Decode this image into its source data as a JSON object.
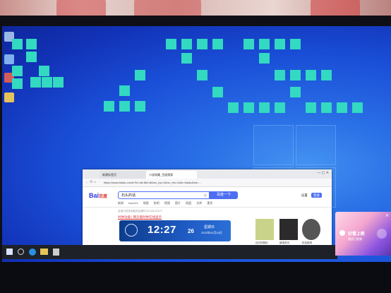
{
  "desktop": {
    "icons": [
      {
        "name": "recycle-bin",
        "color": "#9ab7e6"
      },
      {
        "name": "this-pc",
        "color": "#7fb0ef"
      },
      {
        "name": "control-panel",
        "color": "#d35b5b"
      },
      {
        "name": "folder",
        "color": "#e6c35a"
      }
    ],
    "tile_color": "#33d9c1"
  },
  "browser": {
    "tabs": [
      {
        "label": "新建标签页"
      },
      {
        "label": "小说收藏_百度搜索"
      }
    ],
    "address": "https://www.baidu.com/s?ie=utf-8&f=8&rsv_bp=1&rsv_idx=1&tn=baidu&wd=...",
    "logo_text": "Bai",
    "logo_accent": "百度",
    "search_value": "石头的话",
    "search_button": "百度一下",
    "header_links": [
      "设置",
      "登录"
    ],
    "nav_items": [
      "新闻",
      "hao123",
      "地图",
      "贴吧",
      "视频",
      "图片",
      "网盘",
      "文库",
      "更多"
    ],
    "hint_text": "百度为您找到相关结果约100,000,000个",
    "result_link": "时钟功能 | 网页版时钟在线显示",
    "clock": {
      "time": "12:27",
      "seconds": "26",
      "weekday": "星期日",
      "date": "2022年04月24日"
    },
    "news": [
      {
        "caption": "四月的柳树",
        "color": "#c9d48a"
      },
      {
        "caption": "新闻资讯",
        "color": "#2c2a2a"
      },
      {
        "caption": "科技新闻",
        "color": "#555555"
      }
    ]
  },
  "taskbar": {
    "icons": [
      "start",
      "search",
      "edge",
      "explorer",
      "app"
    ]
  },
  "popup": {
    "title": "好看上新",
    "subtitle": "看热门视频"
  }
}
